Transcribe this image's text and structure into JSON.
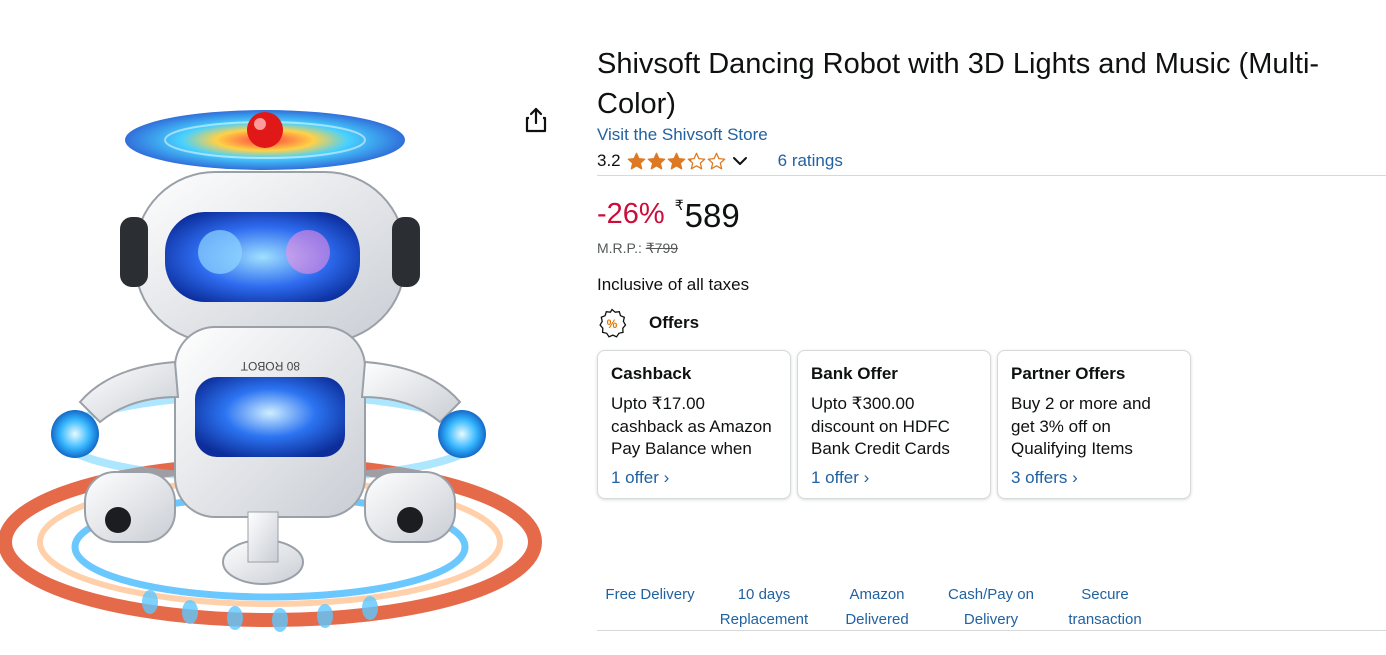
{
  "product": {
    "title": "Shivsoft Dancing Robot with 3D Lights and Music (Multi-Color)",
    "store_link": "Visit the Shivsoft Store",
    "rating_value": "3.2",
    "rating_stars": 3.2,
    "ratings_count": "6 ratings"
  },
  "price": {
    "discount": "-26%",
    "currency_symbol": "₹",
    "amount": "589",
    "mrp_label": "M.R.P.:",
    "mrp_value": "₹799",
    "taxes_note": "Inclusive of all taxes"
  },
  "offers": {
    "heading": "Offers",
    "cards": [
      {
        "title": "Cashback",
        "desc": "Upto ₹17.00 cashback as Amazon Pay Balance when",
        "link": "1 offer ›"
      },
      {
        "title": "Bank Offer",
        "desc": "Upto ₹300.00 discount on HDFC Bank Credit Cards",
        "link": "1 offer ›"
      },
      {
        "title": "Partner Offers",
        "desc": "Buy 2 or more and get 3% off on Qualifying Items",
        "link": "3 offers ›"
      }
    ]
  },
  "features": [
    {
      "label": "Free Delivery"
    },
    {
      "label": "10 days Replacement"
    },
    {
      "label": "Amazon Delivered"
    },
    {
      "label": "Cash/Pay on Delivery"
    },
    {
      "label": "Secure transaction"
    }
  ],
  "icons": {
    "share": "share-icon",
    "star": "star-icon",
    "chevron": "chevron-down-icon",
    "offers": "offer-badge-icon"
  },
  "colors": {
    "link": "#2162a1",
    "discount": "#cc0c39",
    "star": "#de7921",
    "text": "#0f1111"
  }
}
